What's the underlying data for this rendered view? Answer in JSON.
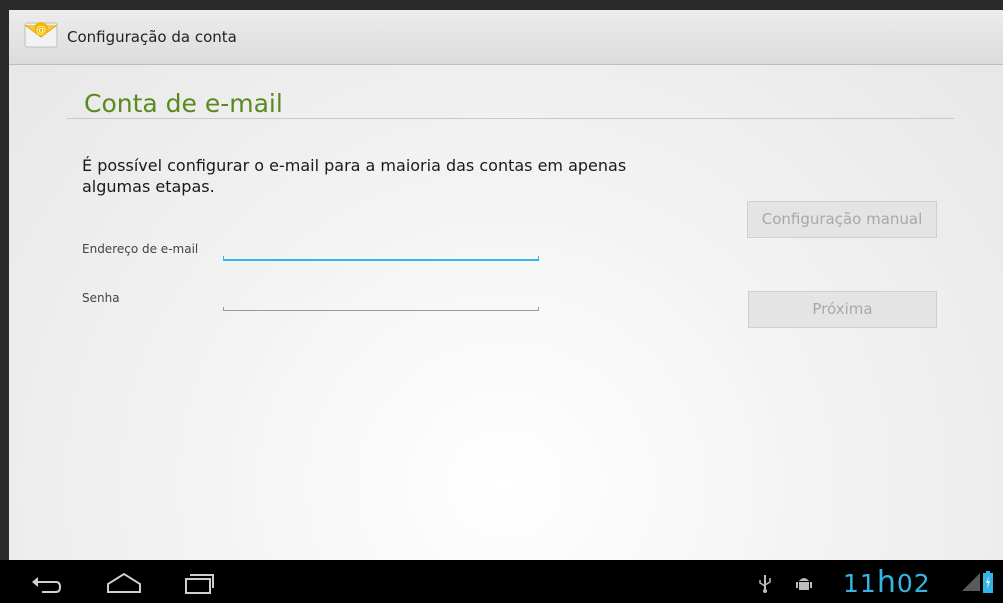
{
  "app": {
    "title": "Configuração da conta",
    "icon": "email-app-icon"
  },
  "page": {
    "title": "Conta de e-mail",
    "intro": "É possível configurar o e-mail para a maioria das contas em apenas algumas etapas."
  },
  "form": {
    "email": {
      "label": "Endereço de e-mail",
      "value": "",
      "focused": true
    },
    "password": {
      "label": "Senha",
      "value": ""
    }
  },
  "buttons": {
    "manual_setup": "Configuração manual",
    "next": "Próxima"
  },
  "statusbar": {
    "time_hours": "11",
    "time_h": "h",
    "time_minutes": "02",
    "icons": [
      "usb-icon",
      "android-debug-icon",
      "signal-icon",
      "battery-icon"
    ]
  },
  "navbar": {
    "icons": [
      "back-icon",
      "home-icon",
      "recent-apps-icon"
    ]
  },
  "colors": {
    "accent": "#33b5e5",
    "title_green": "#5a8a1f"
  }
}
